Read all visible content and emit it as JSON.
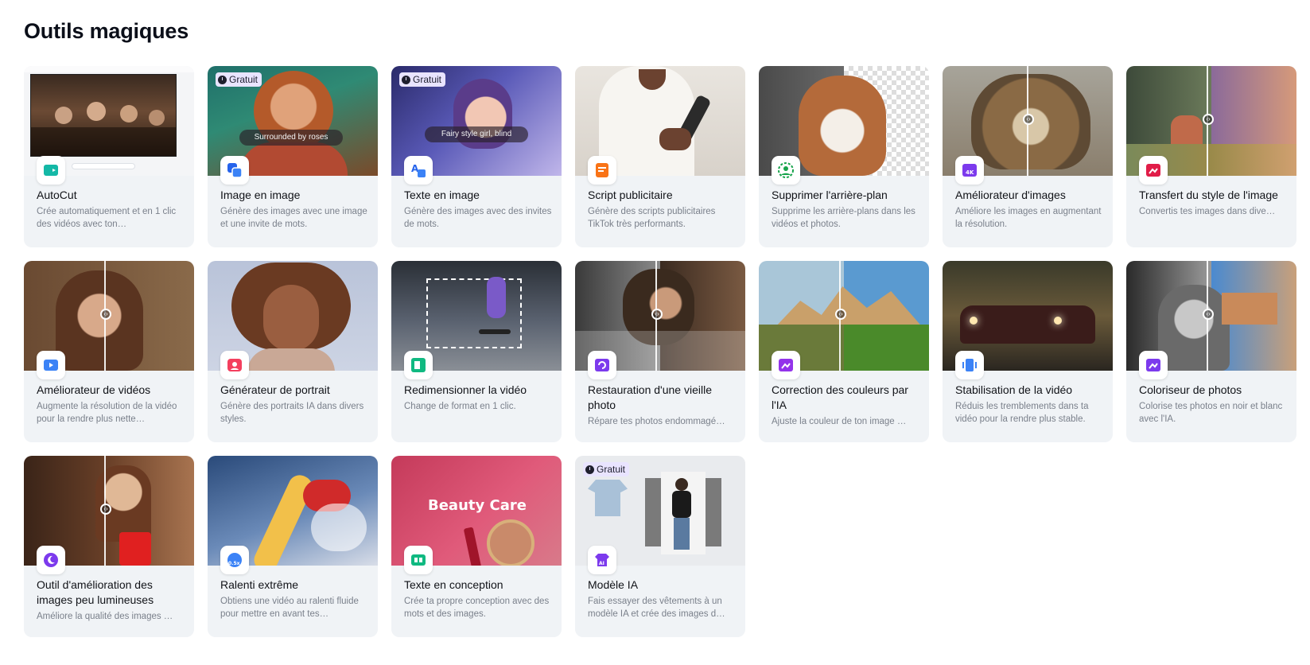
{
  "page": {
    "title": "Outils magiques"
  },
  "badge_label": "Gratuit",
  "colors": {
    "accent": "#7c3aed",
    "card_bg": "#f0f3f6",
    "badge_bg": "#e9e4ff"
  },
  "cards": [
    {
      "name": "AutoCut",
      "desc": "Crée automatiquement et en 1 clic des vidéos avec ton…",
      "icon": "autocut-icon",
      "free": false
    },
    {
      "name": "Image en image",
      "desc": "Génère des images avec une image et une invite de mots.",
      "icon": "image-to-image-icon",
      "free": true,
      "prompt": "Surrounded by roses"
    },
    {
      "name": "Texte en image",
      "desc": "Génère des images avec des invites de mots.",
      "icon": "text-to-image-icon",
      "free": true,
      "prompt": "Fairy style girl, blind"
    },
    {
      "name": "Script publicitaire",
      "desc": "Génère des scripts publicitaires TikTok très performants.",
      "icon": "ad-script-icon",
      "free": false
    },
    {
      "name": "Supprimer l'arrière-plan",
      "desc": "Supprime les arrière-plans dans les vidéos et photos.",
      "icon": "remove-background-icon",
      "free": false
    },
    {
      "name": "Améliorateur d'images",
      "desc": "Améliore les images en augmentant la résolution.",
      "icon": "image-enhancer-icon",
      "free": false,
      "icon_text": "4K"
    },
    {
      "name": "Transfert du style de l'image",
      "desc": "Convertis tes images dans dive…",
      "icon": "style-transfer-icon",
      "free": false
    },
    {
      "name": "Améliorateur de vidéos",
      "desc": "Augmente la résolution de la vidéo pour la rendre plus nette…",
      "icon": "video-enhancer-icon",
      "free": false
    },
    {
      "name": "Générateur de portrait",
      "desc": "Génère des portraits IA dans divers styles.",
      "icon": "portrait-generator-icon",
      "free": false
    },
    {
      "name": "Redimensionner la vidéo",
      "desc": "Change de format en 1 clic.",
      "icon": "resize-video-icon",
      "free": false
    },
    {
      "name": "Restauration d'une vieille photo",
      "desc": "Répare tes photos endommagé…",
      "icon": "photo-restore-icon",
      "free": false
    },
    {
      "name": "Correction des couleurs par l'IA",
      "desc": "Ajuste la couleur de ton image …",
      "icon": "color-correction-icon",
      "free": false
    },
    {
      "name": "Stabilisation de la vidéo",
      "desc": "Réduis les tremblements dans ta vidéo pour la rendre plus stable.",
      "icon": "video-stabilization-icon",
      "free": false
    },
    {
      "name": "Coloriseur de photos",
      "desc": "Colorise tes photos en noir et blanc avec l'IA.",
      "icon": "photo-colorizer-icon",
      "free": false
    },
    {
      "name": "Outil d'amélioration des images peu lumineuses",
      "desc": "Améliore la qualité des images …",
      "icon": "low-light-icon",
      "free": false
    },
    {
      "name": "Ralenti extrême",
      "desc": "Obtiens une vidéo au ralenti fluide pour mettre en avant tes…",
      "icon": "slow-motion-icon",
      "free": false,
      "icon_text": "0.5x"
    },
    {
      "name": "Texte en conception",
      "desc": "Crée ta propre conception avec des mots et des images.",
      "icon": "text-to-design-icon",
      "free": false,
      "thumb_text": "Beauty Care"
    },
    {
      "name": "Modèle IA",
      "desc": "Fais essayer des vêtements à un modèle IA et crée des images d…",
      "icon": "ai-model-icon",
      "free": true,
      "icon_text": "AI"
    }
  ]
}
